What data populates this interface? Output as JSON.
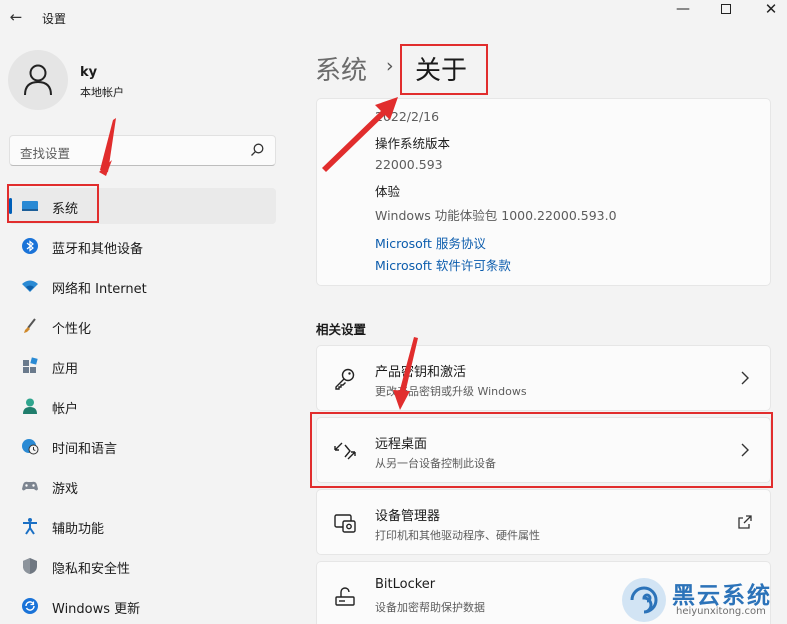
{
  "window": {
    "title": "设置",
    "back_glyph": "←",
    "minimize_glyph": "—",
    "close_glyph": "✕"
  },
  "user": {
    "name": "ky",
    "account_type": "本地帐户"
  },
  "search": {
    "placeholder": "查找设置"
  },
  "sidebar": {
    "items": [
      {
        "label": "系统",
        "icon": "system-icon",
        "active": true
      },
      {
        "label": "蓝牙和其他设备",
        "icon": "bluetooth-icon"
      },
      {
        "label": "网络和 Internet",
        "icon": "wifi-icon"
      },
      {
        "label": "个性化",
        "icon": "brush-icon"
      },
      {
        "label": "应用",
        "icon": "apps-icon"
      },
      {
        "label": "帐户",
        "icon": "account-icon"
      },
      {
        "label": "时间和语言",
        "icon": "globe-clock-icon"
      },
      {
        "label": "游戏",
        "icon": "gamepad-icon"
      },
      {
        "label": "辅助功能",
        "icon": "accessibility-icon"
      },
      {
        "label": "隐私和安全性",
        "icon": "shield-icon"
      },
      {
        "label": "Windows 更新",
        "icon": "update-icon"
      }
    ]
  },
  "breadcrumb": {
    "parent": "系统",
    "separator": "›",
    "current": "关于"
  },
  "specs": {
    "install_date": "2022/2/16",
    "os_build_label": "操作系统版本",
    "os_build_value": "22000.593",
    "experience_label": "体验",
    "experience_value": "Windows 功能体验包 1000.22000.593.0",
    "link_services": "Microsoft 服务协议",
    "link_license": "Microsoft 软件许可条款"
  },
  "related": {
    "title": "相关设置",
    "items": [
      {
        "title": "产品密钥和激活",
        "subtitle": "更改产品密钥或升级 Windows",
        "icon": "key-icon",
        "action": "chevron"
      },
      {
        "title": "远程桌面",
        "subtitle": "从另一台设备控制此设备",
        "icon": "remote-desktop-icon",
        "action": "chevron"
      },
      {
        "title": "设备管理器",
        "subtitle": "打印机和其他驱动程序、硬件属性",
        "icon": "device-manager-icon",
        "action": "external"
      },
      {
        "title": "BitLocker",
        "subtitle": "设备加密帮助保护数据",
        "icon": "bitlocker-icon",
        "action": "chevron"
      }
    ]
  },
  "watermark": {
    "brand": "黑云系统",
    "url": "heiyunxitong.com"
  },
  "colors": {
    "accent": "#005fb8",
    "link": "#0b5cad",
    "annotation": "#e12d2d"
  }
}
